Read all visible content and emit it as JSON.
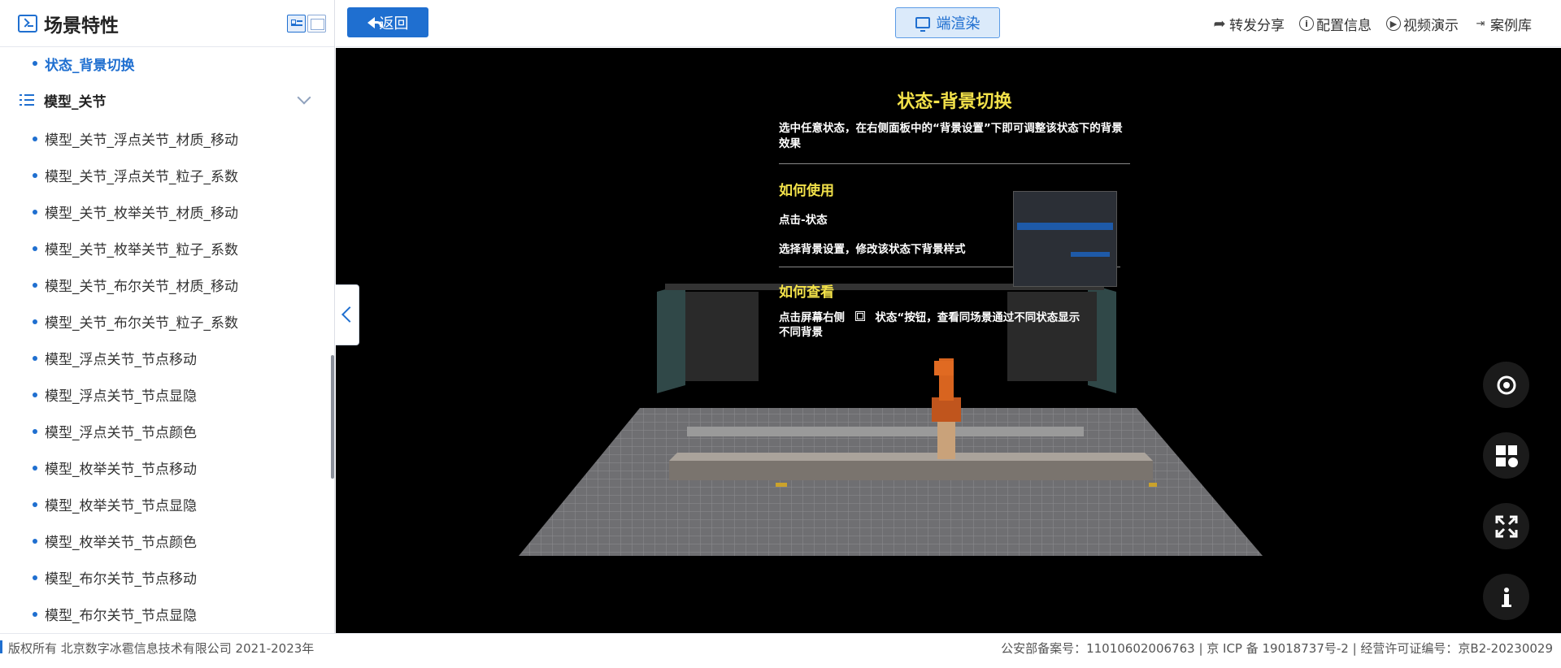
{
  "sidebar": {
    "title": "场景特性",
    "active_item": "状态_背景切换",
    "group": {
      "label": "模型_关节"
    },
    "items": [
      "模型_关节_浮点关节_材质_移动",
      "模型_关节_浮点关节_粒子_系数",
      "模型_关节_枚举关节_材质_移动",
      "模型_关节_枚举关节_粒子_系数",
      "模型_关节_布尔关节_材质_移动",
      "模型_关节_布尔关节_粒子_系数",
      "模型_浮点关节_节点移动",
      "模型_浮点关节_节点显隐",
      "模型_浮点关节_节点颜色",
      "模型_枚举关节_节点移动",
      "模型_枚举关节_节点显隐",
      "模型_枚举关节_节点颜色",
      "模型_布尔关节_节点移动",
      "模型_布尔关节_节点显隐"
    ]
  },
  "topbar": {
    "back_label": "返回",
    "render_label": "端渲染",
    "actions": [
      "转发分享",
      "配置信息",
      "视频演示",
      "案例库"
    ]
  },
  "hud": {
    "title": "状态-背景切换",
    "description": "选中任意状态，在右侧面板中的“背景设置”下即可调整该状态下的背景效果",
    "how_to_use": "如何使用",
    "step1": "点击-状态",
    "step2": "选择背景设置，修改该状态下背景样式",
    "how_to_view": "如何查看",
    "view_text_a": "点击屏幕右侧",
    "view_text_b": "状态“按钮，查看同场景通过不同状态显示",
    "view_text_c": "不同背景"
  },
  "footer": {
    "copyright": "版权所有 北京数字冰雹信息技术有限公司 2021-2023年",
    "registration": "公安部备案号：11010602006763 | 京 ICP 备 19018737号-2 | 经营许可证编号：京B2-20230029"
  },
  "colors": {
    "accent": "#1f6fd0",
    "hud_yellow": "#f3e24a",
    "viewport_bg": "#000000"
  },
  "icons": [
    "terminal-logo-icon",
    "list-view-icon",
    "image-view-icon",
    "list-icon",
    "chevron-down-icon",
    "back-arrow-icon",
    "monitor-icon",
    "share-icon",
    "info-icon",
    "play-icon",
    "export-icon",
    "chevron-left-icon",
    "rotate-view-icon",
    "layout-icon",
    "fullscreen-icon",
    "info-circle-icon"
  ]
}
